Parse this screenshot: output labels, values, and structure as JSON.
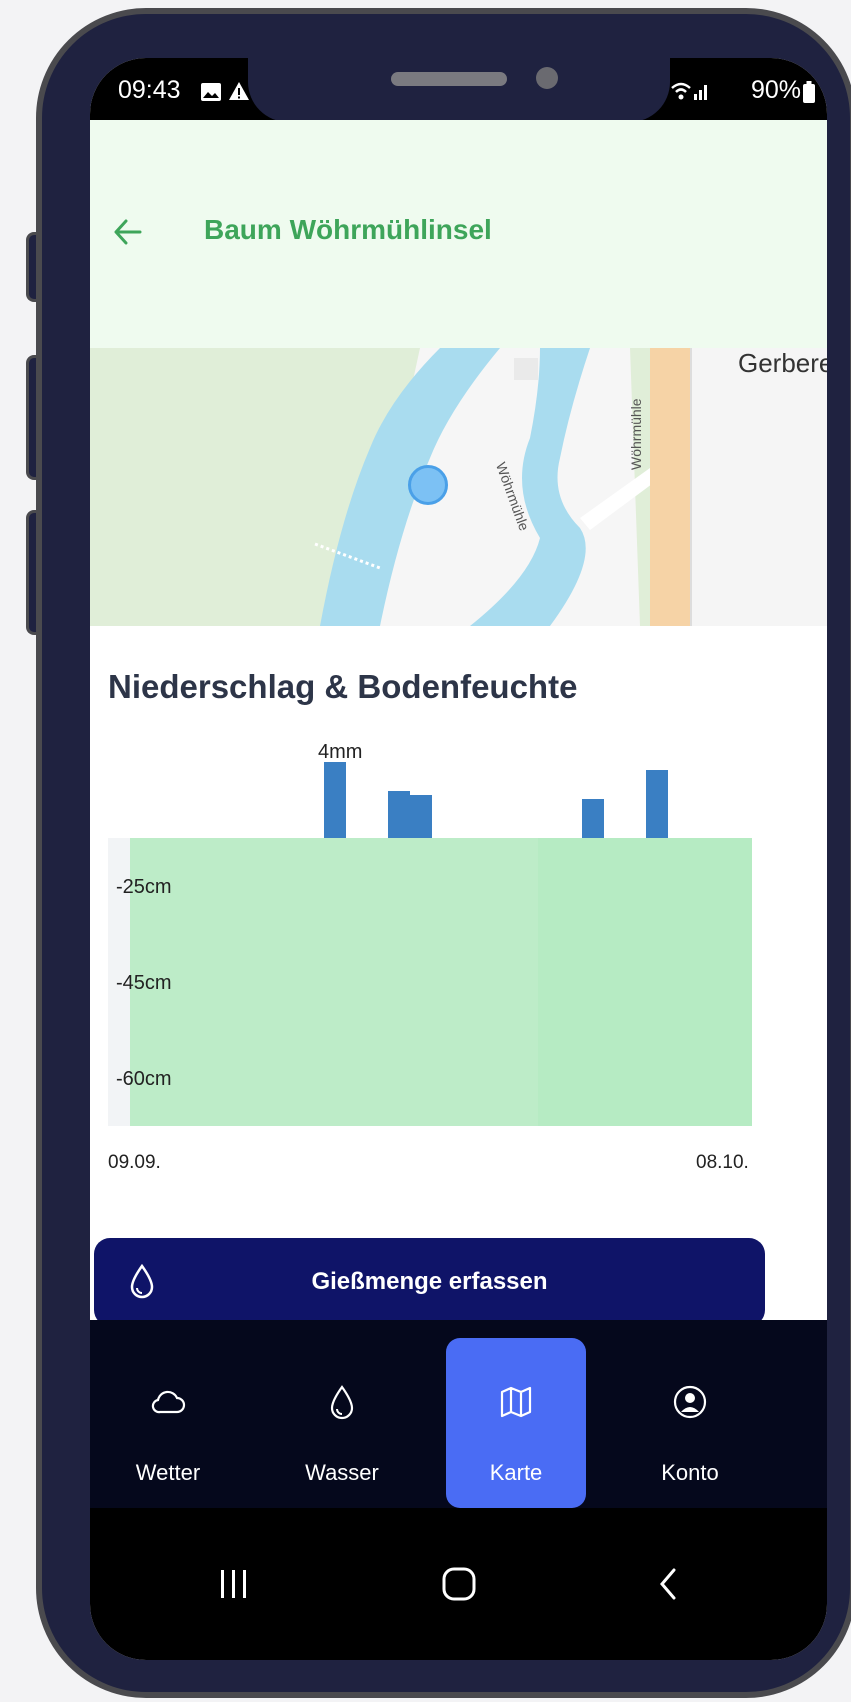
{
  "status": {
    "time": "09:43",
    "right": "90%"
  },
  "header": {
    "title": "Baum Wöhrmühlinsel"
  },
  "map": {
    "street_labels": [
      "Wöhrmühle",
      "Wöhrmühle"
    ],
    "place_label": "Gerbere"
  },
  "chart_section": {
    "title": "Niederschlag & Bodenfeuchte"
  },
  "chart_data": {
    "type": "bar",
    "title": "Niederschlag & Bodenfeuchte",
    "x_range": [
      "09.09.",
      "08.10."
    ],
    "precip_label": "4mm",
    "precip_values_mm": [
      4,
      2.5,
      2.3,
      2.1,
      3.6
    ],
    "soil_depth_labels": [
      "-25cm",
      "-45cm",
      "-60cm"
    ]
  },
  "cta": {
    "label": "Gießmenge erfassen"
  },
  "nav": [
    {
      "label": "Wetter",
      "icon": "cloud-icon"
    },
    {
      "label": "Wasser",
      "icon": "droplet-icon"
    },
    {
      "label": "Karte",
      "icon": "map-icon"
    },
    {
      "label": "Konto",
      "icon": "user-circle-icon"
    }
  ],
  "colors": {
    "accent": "#3ea55a",
    "active": "#4a6cf4",
    "cta": "#0f1468",
    "bar": "#3a7fc3"
  }
}
